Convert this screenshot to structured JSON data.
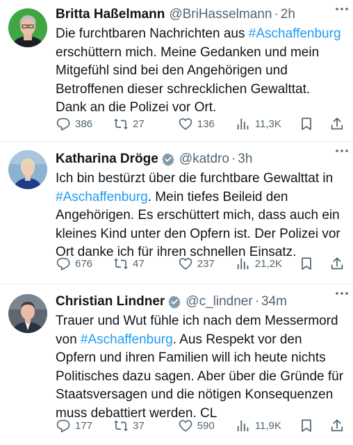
{
  "tweets": [
    {
      "name": "Britta Haßelmann",
      "verified": false,
      "handle": "@BriHasselmann",
      "dot": "·",
      "time": "2h",
      "text_before": "Die furchtbaren Nachrichten aus ",
      "hashtag": "#Aschaffenburg",
      "text_after": "\nerschüttern mich. Meine Gedanken und mein\nMitgefühl sind bei den Angehörigen und\nBetroffenen dieser schrecklichen Gewalttat.\nDank an die Polizei vor Ort.",
      "replies": "386",
      "retweets": "27",
      "likes": "136",
      "views": "11,3K"
    },
    {
      "name": "Katharina Dröge",
      "verified": true,
      "handle": "@katdro",
      "dot": "·",
      "time": "3h",
      "text_before": "Ich bin bestürzt über die furchtbare Gewalttat in\n",
      "hashtag": "#Aschaffenburg",
      "text_after": ". Mein tiefes Beileid den\nAngehörigen. Es erschüttert mich, dass auch ein\nkleines Kind unter den Opfern ist. Der Polizei vor\nOrt danke ich für ihren schnellen Einsatz.",
      "replies": "676",
      "retweets": "47",
      "likes": "237",
      "views": "21,2K"
    },
    {
      "name": "Christian Lindner",
      "verified": true,
      "handle": "@c_lindner",
      "dot": "·",
      "time": "34m",
      "text_before": "Trauer und Wut fühle ich nach dem Messermord\nvon ",
      "hashtag": "#Aschaffenburg",
      "text_after": ". Aus Respekt vor den\nOpfern und ihren Familien will ich heute nichts\nPolitisches dazu sagen. Aber über die Gründe für\nStaatsversagen und die nötigen Konsequenzen\nmuss debattiert werden. CL",
      "replies": "177",
      "retweets": "37",
      "likes": "590",
      "views": "11,9K"
    }
  ],
  "icons": {
    "reply": "reply-icon",
    "retweet": "retweet-icon",
    "like": "heart-icon",
    "views": "views-icon",
    "bookmark": "bookmark-icon",
    "share": "share-icon",
    "more": "more-icon",
    "verified": "verified-badge-icon"
  },
  "colors": {
    "hashtag": "#1d9bf0",
    "verified": "#829aab",
    "secondary_text": "#536471",
    "divider": "#e6ecf0"
  }
}
